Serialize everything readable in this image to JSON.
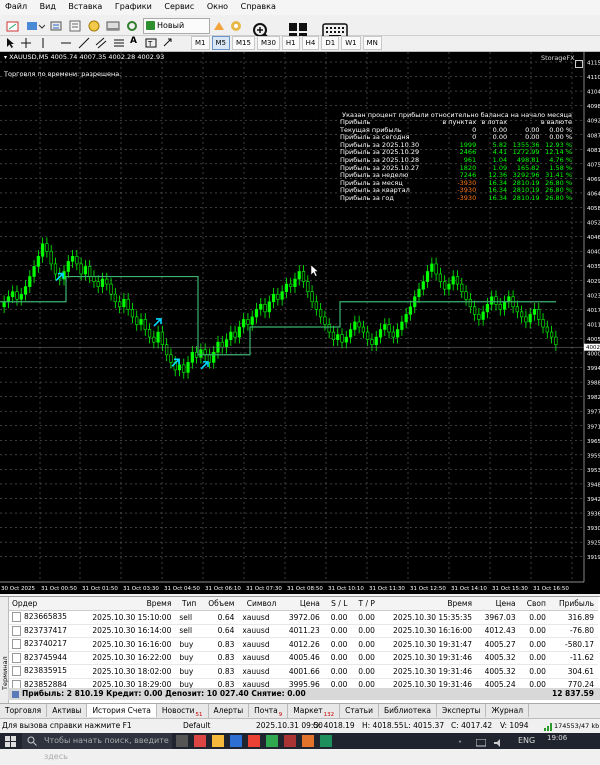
{
  "menu": [
    "Файл",
    "Вид",
    "Вставка",
    "Графики",
    "Сервис",
    "Окно",
    "Справка"
  ],
  "toolbar": {
    "new_order_label": "Новый ордер"
  },
  "timeframes": [
    "M1",
    "M5",
    "M15",
    "M30",
    "H1",
    "H4",
    "D1",
    "W1",
    "MN"
  ],
  "chart": {
    "header": "XAUUSD,M5  4005.74 4007.35 4002.28 4002.93",
    "trading_notice": "Торговля по времени: разрешена.",
    "watermark": "StorageFX",
    "stats_title": "Указан процент прибыли относительно баланса на начало месяца",
    "stats_headers": [
      "Прибыль",
      "в пунктах",
      "в лотах",
      "в валюте"
    ],
    "stats_rows": [
      [
        "Текущая прибыль",
        "0",
        "0.00",
        "0.00",
        "0.00 %"
      ],
      [
        "Прибыль за сегодня",
        "0",
        "0.00",
        "0.00",
        "0.00 %"
      ],
      [
        "Прибыль за 2025.10.30",
        "1999",
        "5.82",
        "1355.36",
        "12.93 %"
      ],
      [
        "Прибыль за 2025.10.29",
        "2466",
        "4.41",
        "1272.99",
        "12.14 %"
      ],
      [
        "Прибыль за 2025.10.28",
        "961",
        "1.04",
        "498.81",
        "4.76 %"
      ],
      [
        "Прибыль за 2025.10.27",
        "1820",
        "1.09",
        "165.82",
        "1.58 %"
      ],
      [
        "Прибыль за неделю",
        "7246",
        "12.36",
        "3292.96",
        "31.41 %"
      ],
      [
        "Прибыль за месяц",
        "-3930",
        "16.34",
        "2810.19",
        "26.80 %"
      ],
      [
        "Прибыль за квартал",
        "-3930",
        "16.34",
        "2810.19",
        "26.80 %"
      ],
      [
        "Прибыль за год",
        "-3930",
        "16.34",
        "2810.19",
        "26.80 %"
      ]
    ],
    "price_labels": [
      "4115",
      "4110",
      "4104",
      "4098",
      "4092",
      "4087",
      "4081",
      "4075",
      "4069",
      "4064",
      "4058",
      "4052",
      "4046",
      "4040",
      "4035",
      "4029",
      "4023",
      "4017",
      "4011",
      "4005",
      "4000",
      "3994",
      "3988",
      "3982",
      "3977",
      "3971",
      "3965",
      "3959",
      "3953",
      "3948",
      "3942",
      "3936",
      "3930",
      "3925",
      "3919"
    ],
    "current_price": "4002",
    "time_labels": [
      "30 Oct 2025",
      "31 Oct 00:50",
      "31 Oct 01:50",
      "31 Oct 03:30",
      "31 Oct 04:50",
      "31 Oct 06:10",
      "31 Oct 07:30",
      "31 Oct 08:50",
      "31 Oct 10:10",
      "31 Oct 11:30",
      "31 Oct 12:50",
      "31 Oct 14:10",
      "31 Oct 15:30",
      "31 Oct 16:50"
    ]
  },
  "terminal": {
    "columns": [
      "Ордер",
      "Время",
      "Тип",
      "Объем",
      "Символ",
      "Цена",
      "S / L",
      "T / P",
      "Время",
      "Цена",
      "Своп",
      "Прибыль"
    ],
    "rows": [
      [
        "823665835",
        "2025.10.30 15:10:00",
        "sell",
        "0.64",
        "xauusd",
        "3972.06",
        "0.00",
        "0.00",
        "2025.10.30 15:35:35",
        "3967.03",
        "0.00",
        "316.89"
      ],
      [
        "823737417",
        "2025.10.30 16:14:00",
        "sell",
        "0.64",
        "xauusd",
        "4011.23",
        "0.00",
        "0.00",
        "2025.10.30 16:16:00",
        "4012.43",
        "0.00",
        "-76.80"
      ],
      [
        "823740217",
        "2025.10.30 16:16:00",
        "buy",
        "0.83",
        "xauusd",
        "4012.26",
        "0.00",
        "0.00",
        "2025.10.30 19:31:47",
        "4005.27",
        "0.00",
        "-580.17"
      ],
      [
        "823745944",
        "2025.10.30 16:22:00",
        "buy",
        "0.83",
        "xauusd",
        "4005.46",
        "0.00",
        "0.00",
        "2025.10.30 19:31:46",
        "4005.32",
        "0.00",
        "-11.62"
      ],
      [
        "823835915",
        "2025.10.30 18:02:00",
        "buy",
        "0.83",
        "xauusd",
        "4001.66",
        "0.00",
        "0.00",
        "2025.10.30 19:31:46",
        "4005.32",
        "0.00",
        "304.61"
      ],
      [
        "823852884",
        "2025.10.30 18:29:00",
        "buy",
        "0.83",
        "xauusd",
        "3995.96",
        "0.00",
        "0.00",
        "2025.10.30 19:31:46",
        "4005.24",
        "0.00",
        "770.24"
      ]
    ],
    "summary": "Прибыль: 2 810.19  Кредит: 0.00  Депозит: 10 027.40  Снятие: 0.00",
    "summary_total": "12 837.59"
  },
  "tabs": [
    {
      "label": "Торговля",
      "badge": ""
    },
    {
      "label": "Активы",
      "badge": ""
    },
    {
      "label": "История Счета",
      "badge": ""
    },
    {
      "label": "Новости",
      "badge": "51"
    },
    {
      "label": "Алерты",
      "badge": ""
    },
    {
      "label": "Почта",
      "badge": "9"
    },
    {
      "label": "Маркет",
      "badge": "132"
    },
    {
      "label": "Статьи",
      "badge": ""
    },
    {
      "label": "Библиотека",
      "badge": ""
    },
    {
      "label": "Эксперты",
      "badge": ""
    },
    {
      "label": "Журнал",
      "badge": ""
    }
  ],
  "side_label": "Терминал",
  "status": {
    "help": "Для вызова справки нажмите F1",
    "profile": "Default",
    "datetime": "2025.10.31 09:50",
    "open": "O: 4018.19",
    "high": "H: 4018.55",
    "low": "L: 4015.37",
    "close": "C: 4017.42",
    "volume": "V: 1094",
    "traffic": "174553/47 kb"
  },
  "taskbar": {
    "search_placeholder": "Чтобы начать поиск, введите здесь",
    "lang": "ENG",
    "time": "19:06"
  },
  "colors": {
    "bull": "#00ff00",
    "bear": "#00ff00",
    "ma": "#3cb371",
    "arrow": "#00d8ff",
    "grid": "#7a7a7a"
  }
}
